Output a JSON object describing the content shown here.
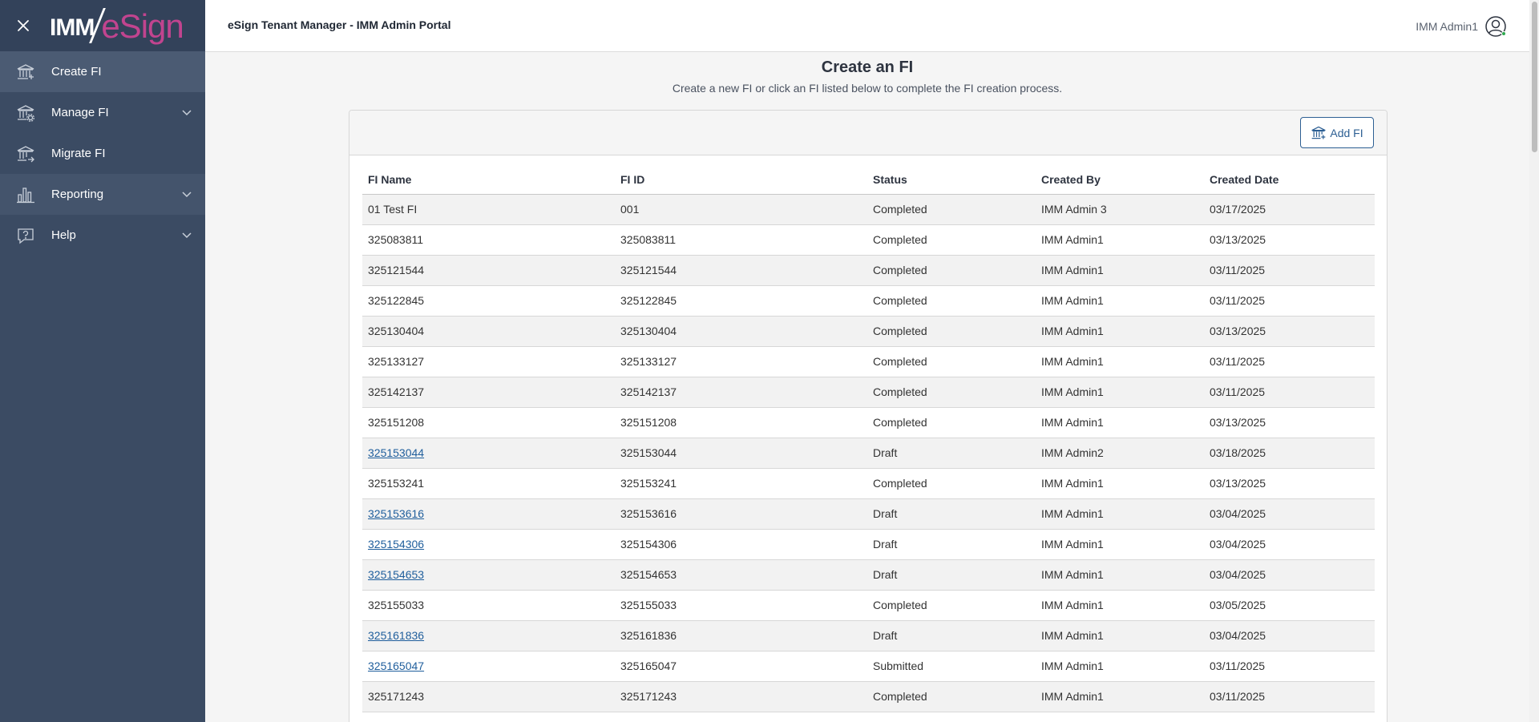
{
  "app": {
    "portal_title": "eSign Tenant Manager - IMM Admin Portal",
    "logo_imm": "IMM",
    "logo_esign": "eSign",
    "user_name": "IMM Admin1"
  },
  "colors": {
    "sidebar_bg": "#3b4b63",
    "accent": "#2d5f93",
    "logo_pink": "#c1448f",
    "link": "#1f5e9c"
  },
  "sidebar": {
    "items": [
      {
        "label": "Create FI",
        "icon": "bank-icon",
        "expandable": false
      },
      {
        "label": "Manage FI",
        "icon": "bank-settings-icon",
        "expandable": true
      },
      {
        "label": "Migrate FI",
        "icon": "bank-migrate-icon",
        "expandable": false
      },
      {
        "label": "Reporting",
        "icon": "bar-chart-icon",
        "expandable": true
      },
      {
        "label": "Help",
        "icon": "help-icon",
        "expandable": true
      }
    ]
  },
  "page": {
    "title": "Create an FI",
    "subtitle": "Create a new FI or click an FI listed below to complete the FI creation process."
  },
  "toolbar": {
    "add_label": "Add FI"
  },
  "table": {
    "columns": [
      "FI Name",
      "FI ID",
      "Status",
      "Created By",
      "Created Date"
    ],
    "rows": [
      {
        "name": "01 Test FI",
        "id": "001",
        "status": "Completed",
        "created_by": "IMM Admin 3",
        "date": "03/17/2025",
        "link": false
      },
      {
        "name": "325083811",
        "id": "325083811",
        "status": "Completed",
        "created_by": "IMM Admin1",
        "date": "03/13/2025",
        "link": false
      },
      {
        "name": "325121544",
        "id": "325121544",
        "status": "Completed",
        "created_by": "IMM Admin1",
        "date": "03/11/2025",
        "link": false
      },
      {
        "name": "325122845",
        "id": "325122845",
        "status": "Completed",
        "created_by": "IMM Admin1",
        "date": "03/11/2025",
        "link": false
      },
      {
        "name": "325130404",
        "id": "325130404",
        "status": "Completed",
        "created_by": "IMM Admin1",
        "date": "03/13/2025",
        "link": false
      },
      {
        "name": "325133127",
        "id": "325133127",
        "status": "Completed",
        "created_by": "IMM Admin1",
        "date": "03/11/2025",
        "link": false
      },
      {
        "name": "325142137",
        "id": "325142137",
        "status": "Completed",
        "created_by": "IMM Admin1",
        "date": "03/11/2025",
        "link": false
      },
      {
        "name": "325151208",
        "id": "325151208",
        "status": "Completed",
        "created_by": "IMM Admin1",
        "date": "03/13/2025",
        "link": false
      },
      {
        "name": "325153044",
        "id": "325153044",
        "status": "Draft",
        "created_by": "IMM Admin2",
        "date": "03/18/2025",
        "link": true
      },
      {
        "name": "325153241",
        "id": "325153241",
        "status": "Completed",
        "created_by": "IMM Admin1",
        "date": "03/13/2025",
        "link": false
      },
      {
        "name": "325153616",
        "id": "325153616",
        "status": "Draft",
        "created_by": "IMM Admin1",
        "date": "03/04/2025",
        "link": true
      },
      {
        "name": "325154306",
        "id": "325154306",
        "status": "Draft",
        "created_by": "IMM Admin1",
        "date": "03/04/2025",
        "link": true
      },
      {
        "name": "325154653",
        "id": "325154653",
        "status": "Draft",
        "created_by": "IMM Admin1",
        "date": "03/04/2025",
        "link": true
      },
      {
        "name": "325155033",
        "id": "325155033",
        "status": "Completed",
        "created_by": "IMM Admin1",
        "date": "03/05/2025",
        "link": false
      },
      {
        "name": "325161836",
        "id": "325161836",
        "status": "Draft",
        "created_by": "IMM Admin1",
        "date": "03/04/2025",
        "link": true
      },
      {
        "name": "325165047",
        "id": "325165047",
        "status": "Submitted",
        "created_by": "IMM Admin1",
        "date": "03/11/2025",
        "link": true
      },
      {
        "name": "325171243",
        "id": "325171243",
        "status": "Completed",
        "created_by": "IMM Admin1",
        "date": "03/11/2025",
        "link": false
      }
    ]
  }
}
